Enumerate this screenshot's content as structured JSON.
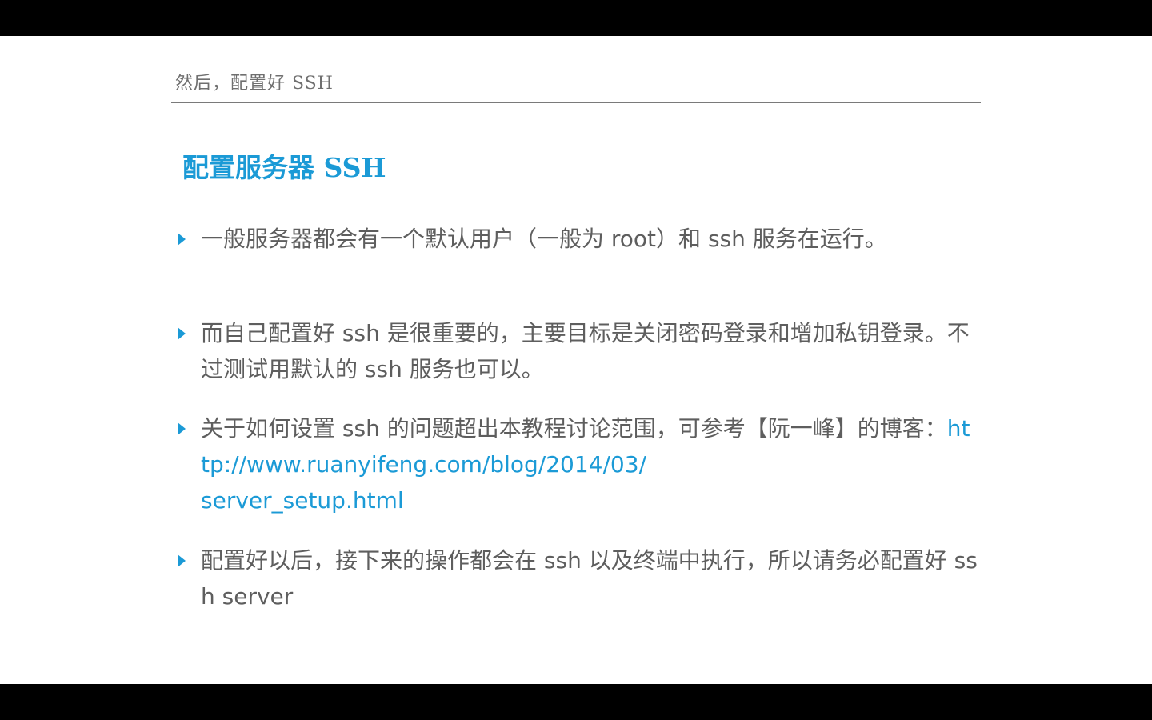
{
  "slide": {
    "header_title": "然后，配置好 SSH",
    "section_title": "配置服务器 SSH",
    "bullets": [
      {
        "text": "一般服务器都会有一个默认用户（一般为 root）和 ssh 服务在运行。"
      },
      {
        "text": "而自己配置好 ssh 是很重要的，主要目标是关闭密码登录和增加私钥登录。不过测试用默认的 ssh 服务也可以。"
      },
      {
        "text_before_link": "关于如何设置 ssh 的问题超出本教程讨论范围，可参考【阮一峰】的博客：",
        "link_line1": "http://www.ruanyifeng.com/blog/2014/03/",
        "link_line2": "server_setup.html"
      },
      {
        "text": "配置好以后，接下来的操作都会在 ssh 以及终端中执行，所以请务必配置好 ssh server"
      }
    ]
  },
  "colors": {
    "accent": "#1b9ad6",
    "body_text": "#5e5e5e",
    "header_text": "#6f6f6f",
    "background": "#ffffff",
    "letterbox": "#000000"
  },
  "icons": {
    "bullet": "triangle-right-icon"
  }
}
